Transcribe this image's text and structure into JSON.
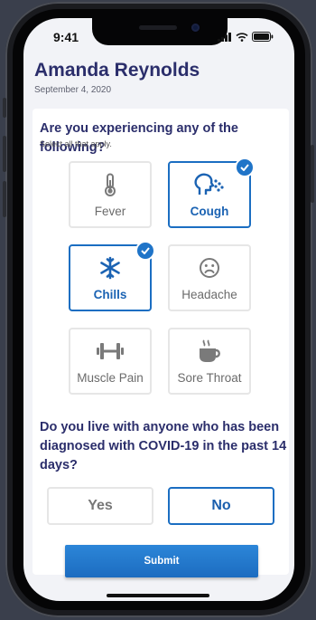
{
  "status_bar": {
    "time": "9:41"
  },
  "header": {
    "name": "Amanda Reynolds",
    "date": "September 4, 2020"
  },
  "symptoms": {
    "question": "Are you experiencing any of the following?",
    "hint": "Select all that apply.",
    "options": [
      {
        "label": "Fever",
        "icon": "thermometer-icon",
        "selected": false
      },
      {
        "label": "Cough",
        "icon": "cough-icon",
        "selected": true
      },
      {
        "label": "Chills",
        "icon": "snowflake-icon",
        "selected": true
      },
      {
        "label": "Headache",
        "icon": "frown-face-icon",
        "selected": false
      },
      {
        "label": "Muscle Pain",
        "icon": "dumbbell-icon",
        "selected": false
      },
      {
        "label": "Sore Throat",
        "icon": "hot-drink-icon",
        "selected": false
      }
    ]
  },
  "exposure": {
    "question_line1": "Do you live with anyone who has been",
    "question_line2": "diagnosed with COVID-19 in the past 14 days?",
    "yes_label": "Yes",
    "no_label": "No",
    "selected": "No"
  },
  "submit_label": "Submit",
  "colors": {
    "accent": "#1b6ec2",
    "title": "#2b2e6b",
    "background": "#f2f3f7"
  }
}
